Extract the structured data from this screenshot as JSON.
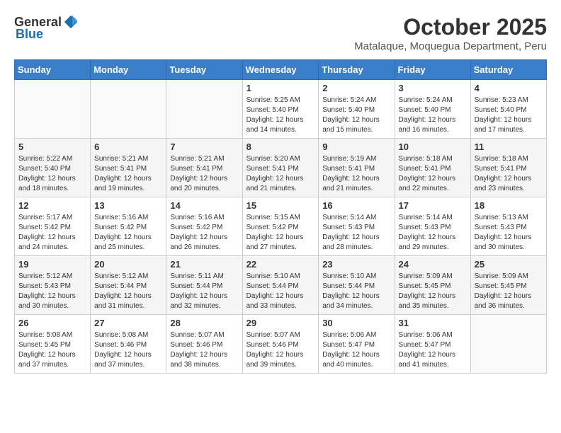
{
  "header": {
    "logo_general": "General",
    "logo_blue": "Blue",
    "month": "October 2025",
    "location": "Matalaque, Moquegua Department, Peru"
  },
  "days_of_week": [
    "Sunday",
    "Monday",
    "Tuesday",
    "Wednesday",
    "Thursday",
    "Friday",
    "Saturday"
  ],
  "weeks": [
    [
      {
        "day": "",
        "info": ""
      },
      {
        "day": "",
        "info": ""
      },
      {
        "day": "",
        "info": ""
      },
      {
        "day": "1",
        "info": "Sunrise: 5:25 AM\nSunset: 5:40 PM\nDaylight: 12 hours\nand 14 minutes."
      },
      {
        "day": "2",
        "info": "Sunrise: 5:24 AM\nSunset: 5:40 PM\nDaylight: 12 hours\nand 15 minutes."
      },
      {
        "day": "3",
        "info": "Sunrise: 5:24 AM\nSunset: 5:40 PM\nDaylight: 12 hours\nand 16 minutes."
      },
      {
        "day": "4",
        "info": "Sunrise: 5:23 AM\nSunset: 5:40 PM\nDaylight: 12 hours\nand 17 minutes."
      }
    ],
    [
      {
        "day": "5",
        "info": "Sunrise: 5:22 AM\nSunset: 5:40 PM\nDaylight: 12 hours\nand 18 minutes."
      },
      {
        "day": "6",
        "info": "Sunrise: 5:21 AM\nSunset: 5:41 PM\nDaylight: 12 hours\nand 19 minutes."
      },
      {
        "day": "7",
        "info": "Sunrise: 5:21 AM\nSunset: 5:41 PM\nDaylight: 12 hours\nand 20 minutes."
      },
      {
        "day": "8",
        "info": "Sunrise: 5:20 AM\nSunset: 5:41 PM\nDaylight: 12 hours\nand 21 minutes."
      },
      {
        "day": "9",
        "info": "Sunrise: 5:19 AM\nSunset: 5:41 PM\nDaylight: 12 hours\nand 21 minutes."
      },
      {
        "day": "10",
        "info": "Sunrise: 5:18 AM\nSunset: 5:41 PM\nDaylight: 12 hours\nand 22 minutes."
      },
      {
        "day": "11",
        "info": "Sunrise: 5:18 AM\nSunset: 5:41 PM\nDaylight: 12 hours\nand 23 minutes."
      }
    ],
    [
      {
        "day": "12",
        "info": "Sunrise: 5:17 AM\nSunset: 5:42 PM\nDaylight: 12 hours\nand 24 minutes."
      },
      {
        "day": "13",
        "info": "Sunrise: 5:16 AM\nSunset: 5:42 PM\nDaylight: 12 hours\nand 25 minutes."
      },
      {
        "day": "14",
        "info": "Sunrise: 5:16 AM\nSunset: 5:42 PM\nDaylight: 12 hours\nand 26 minutes."
      },
      {
        "day": "15",
        "info": "Sunrise: 5:15 AM\nSunset: 5:42 PM\nDaylight: 12 hours\nand 27 minutes."
      },
      {
        "day": "16",
        "info": "Sunrise: 5:14 AM\nSunset: 5:43 PM\nDaylight: 12 hours\nand 28 minutes."
      },
      {
        "day": "17",
        "info": "Sunrise: 5:14 AM\nSunset: 5:43 PM\nDaylight: 12 hours\nand 29 minutes."
      },
      {
        "day": "18",
        "info": "Sunrise: 5:13 AM\nSunset: 5:43 PM\nDaylight: 12 hours\nand 30 minutes."
      }
    ],
    [
      {
        "day": "19",
        "info": "Sunrise: 5:12 AM\nSunset: 5:43 PM\nDaylight: 12 hours\nand 30 minutes."
      },
      {
        "day": "20",
        "info": "Sunrise: 5:12 AM\nSunset: 5:44 PM\nDaylight: 12 hours\nand 31 minutes."
      },
      {
        "day": "21",
        "info": "Sunrise: 5:11 AM\nSunset: 5:44 PM\nDaylight: 12 hours\nand 32 minutes."
      },
      {
        "day": "22",
        "info": "Sunrise: 5:10 AM\nSunset: 5:44 PM\nDaylight: 12 hours\nand 33 minutes."
      },
      {
        "day": "23",
        "info": "Sunrise: 5:10 AM\nSunset: 5:44 PM\nDaylight: 12 hours\nand 34 minutes."
      },
      {
        "day": "24",
        "info": "Sunrise: 5:09 AM\nSunset: 5:45 PM\nDaylight: 12 hours\nand 35 minutes."
      },
      {
        "day": "25",
        "info": "Sunrise: 5:09 AM\nSunset: 5:45 PM\nDaylight: 12 hours\nand 36 minutes."
      }
    ],
    [
      {
        "day": "26",
        "info": "Sunrise: 5:08 AM\nSunset: 5:45 PM\nDaylight: 12 hours\nand 37 minutes."
      },
      {
        "day": "27",
        "info": "Sunrise: 5:08 AM\nSunset: 5:46 PM\nDaylight: 12 hours\nand 37 minutes."
      },
      {
        "day": "28",
        "info": "Sunrise: 5:07 AM\nSunset: 5:46 PM\nDaylight: 12 hours\nand 38 minutes."
      },
      {
        "day": "29",
        "info": "Sunrise: 5:07 AM\nSunset: 5:46 PM\nDaylight: 12 hours\nand 39 minutes."
      },
      {
        "day": "30",
        "info": "Sunrise: 5:06 AM\nSunset: 5:47 PM\nDaylight: 12 hours\nand 40 minutes."
      },
      {
        "day": "31",
        "info": "Sunrise: 5:06 AM\nSunset: 5:47 PM\nDaylight: 12 hours\nand 41 minutes."
      },
      {
        "day": "",
        "info": ""
      }
    ]
  ]
}
